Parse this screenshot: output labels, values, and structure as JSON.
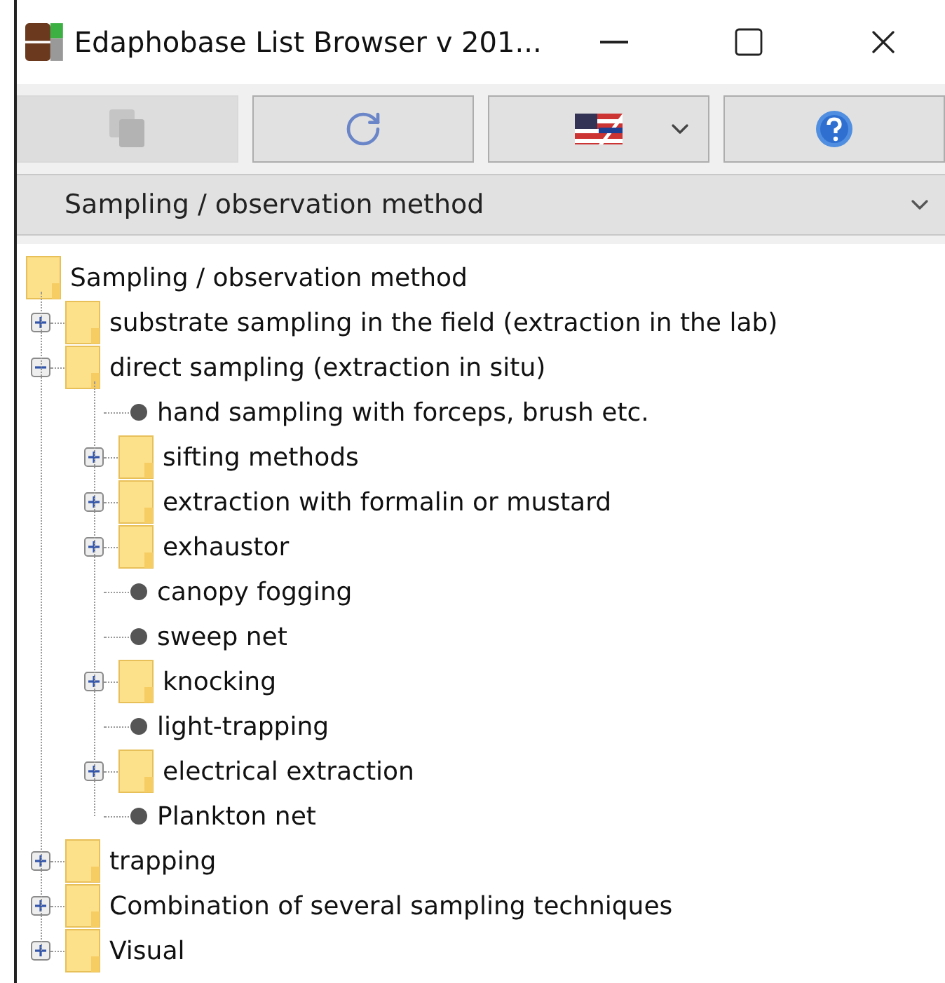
{
  "window": {
    "title": "Edaphobase List Browser v 201..."
  },
  "toolbar": [
    {
      "kind": "copy",
      "disabled": true
    },
    {
      "kind": "refresh",
      "disabled": false
    },
    {
      "kind": "language",
      "disabled": false
    },
    {
      "kind": "help",
      "disabled": false
    }
  ],
  "list_select": {
    "value": "Sampling / observation method"
  },
  "tree": {
    "label": "Sampling / observation method",
    "children": [
      {
        "kind": "folder",
        "label": "substrate sampling in the field (extraction in the lab)",
        "expanded": false
      },
      {
        "kind": "folder",
        "label": "direct sampling (extraction in situ)",
        "expanded": true,
        "children": [
          {
            "kind": "leaf",
            "label": "hand sampling with forceps, brush etc."
          },
          {
            "kind": "folder",
            "label": "sifting methods",
            "expanded": false
          },
          {
            "kind": "folder",
            "label": "extraction with formalin or mustard",
            "expanded": false
          },
          {
            "kind": "folder",
            "label": "exhaustor",
            "expanded": false
          },
          {
            "kind": "leaf",
            "label": "canopy fogging"
          },
          {
            "kind": "leaf",
            "label": "sweep net"
          },
          {
            "kind": "folder",
            "label": "knocking",
            "expanded": false
          },
          {
            "kind": "leaf",
            "label": "light-trapping"
          },
          {
            "kind": "folder",
            "label": "electrical extraction",
            "expanded": false
          },
          {
            "kind": "leaf",
            "label": "Plankton net"
          }
        ]
      },
      {
        "kind": "folder",
        "label": "trapping",
        "expanded": false
      },
      {
        "kind": "folder",
        "label": "Combination of several sampling techniques",
        "expanded": false
      },
      {
        "kind": "folder",
        "label": "Visual",
        "expanded": false
      }
    ]
  }
}
